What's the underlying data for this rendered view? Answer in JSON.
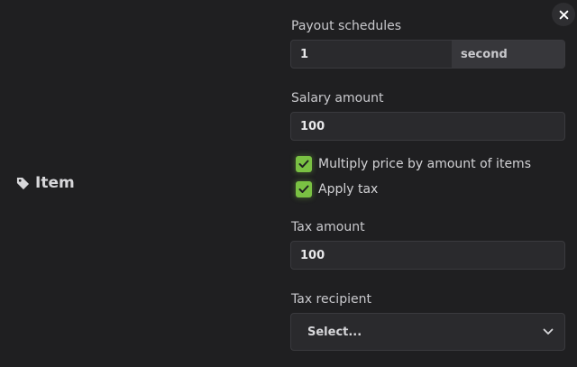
{
  "item": {
    "label": "Item",
    "icon": "tag-icon"
  },
  "close": {
    "icon": "close-icon"
  },
  "payout": {
    "label": "Payout schedules",
    "value": "1",
    "unit": "second"
  },
  "salary": {
    "label": "Salary amount",
    "value": "100"
  },
  "checkboxes": [
    {
      "label": "Multiply price by amount of items",
      "checked": true
    },
    {
      "label": "Apply tax",
      "checked": true
    }
  ],
  "tax": {
    "label": "Tax amount",
    "value": "100"
  },
  "recipient": {
    "label": "Tax recipient",
    "placeholder": "Select...",
    "icon": "chevron-down-icon"
  },
  "colors": {
    "background": "#1f1f21",
    "input_bg": "#2a2a2d",
    "checkbox_green": "#7ac143"
  }
}
